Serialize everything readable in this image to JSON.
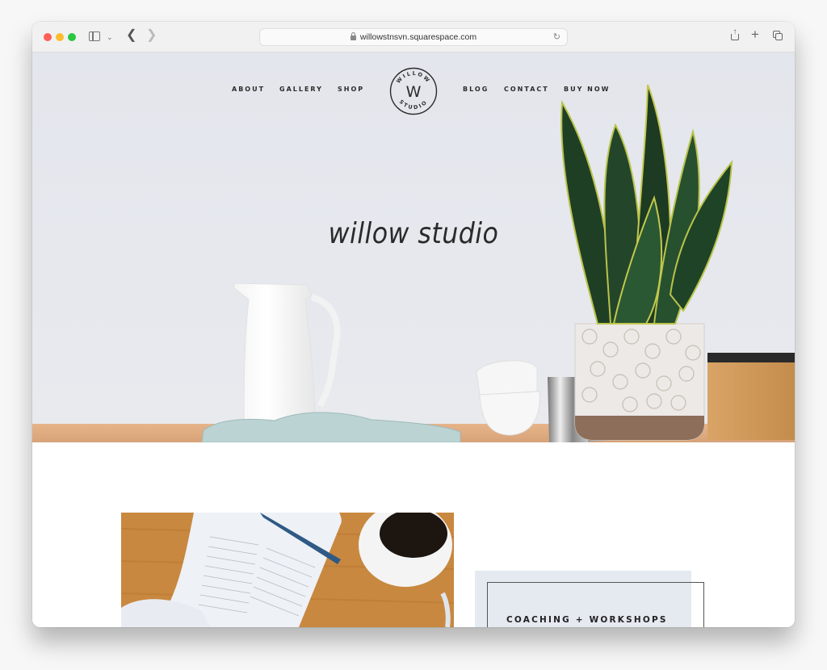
{
  "browser": {
    "url": "willowstnsvn.squarespace.com",
    "icons": [
      "sidebar-icon",
      "chevron-down-icon",
      "back-icon",
      "forward-icon",
      "lock-icon",
      "reload-icon",
      "share-icon",
      "new-tab-icon",
      "tabs-overview-icon"
    ]
  },
  "site": {
    "nav_left": [
      {
        "label": "ABOUT"
      },
      {
        "label": "GALLERY"
      },
      {
        "label": "SHOP"
      }
    ],
    "nav_right": [
      {
        "label": "BLOG"
      },
      {
        "label": "CONTACT"
      },
      {
        "label": "BUY NOW"
      }
    ],
    "logo": {
      "letter": "W",
      "ring_top": "WILLOW",
      "ring_bottom": "STUDIO"
    },
    "hero_title": "willow studio",
    "feature_card": {
      "title": "COACHING + WORKSHOPS"
    }
  },
  "colors": {
    "hero_wall": "#e4e7ed",
    "card_bg": "#e5e9f0",
    "text_dark": "#2b2b2b",
    "wood": "#c98a44"
  }
}
